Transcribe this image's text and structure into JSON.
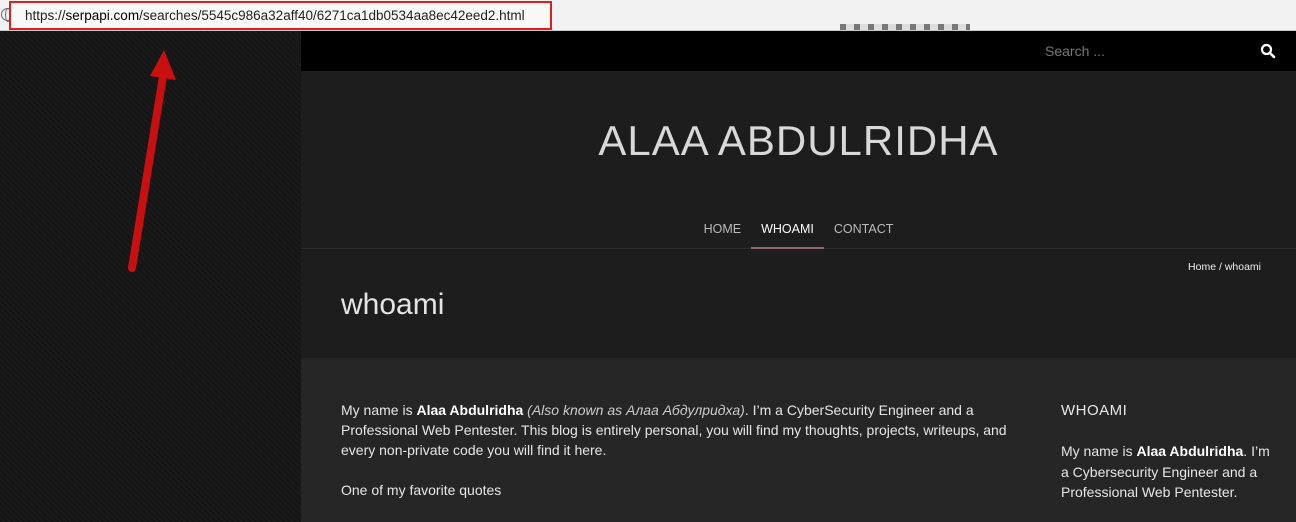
{
  "browser": {
    "url_prefix": "https://",
    "url_host": "serpapi.com",
    "url_path": "/searches/5545c986a32aff40/6271ca1db0534aa8ec42eed2.html"
  },
  "site": {
    "search_placeholder": "Search ...",
    "title": "ALAA ABDULRIDHA",
    "nav": [
      {
        "label": "HOME"
      },
      {
        "label": "WHOAMI"
      },
      {
        "label": "CONTACT"
      }
    ],
    "breadcrumb": {
      "home": "Home",
      "sep": " / ",
      "current": "whoami"
    },
    "page_title": "whoami"
  },
  "content": {
    "p1_a": "My name is ",
    "p1_name": "Alaa Abdulridha",
    "p1_alias": " (Also known as Алаа Абдулридха)",
    "p1_b": ". I’m a CyberSecurity Engineer and a Professional Web Pentester. This blog is entirely personal, you will find my thoughts, projects, writeups, and every non-private code you will find it here.",
    "p2": "One of my favorite quotes"
  },
  "sidebar": {
    "title": "WHOAMI",
    "text_a": "My name is ",
    "name": "Alaa Abdulridha",
    "text_b": ". I’m a Cybersecurity Engineer and a Professional Web Pentester."
  },
  "colors": {
    "annotation_red": "#e01e1e",
    "topbar": "#000000",
    "background": "#1d1d1d"
  }
}
